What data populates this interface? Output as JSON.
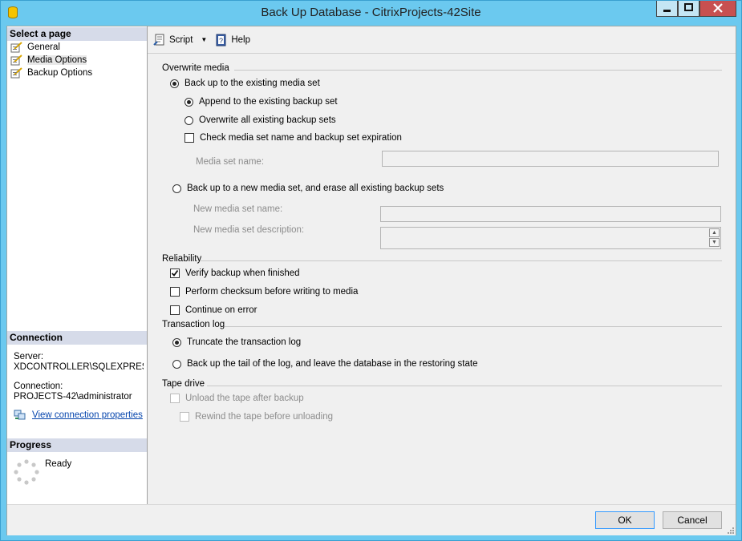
{
  "window": {
    "title": "Back Up Database - CitrixProjects-42Site"
  },
  "left": {
    "select_page_header": "Select a page",
    "pages": [
      {
        "label": "General"
      },
      {
        "label": "Media Options"
      },
      {
        "label": "Backup Options"
      }
    ],
    "connection_header": "Connection",
    "server_label": "Server:",
    "server_value": "XDCONTROLLER\\SQLEXPRESS",
    "connection_label": "Connection:",
    "connection_value": "PROJECTS-42\\administrator",
    "view_connection_link": "View connection properties",
    "progress_header": "Progress",
    "progress_status": "Ready"
  },
  "toolbar": {
    "script_label": "Script",
    "help_label": "Help"
  },
  "overwrite_media": {
    "title": "Overwrite media",
    "existing_media_set": "Back up to the existing media set",
    "append": "Append to the existing backup set",
    "overwrite_all": "Overwrite all existing backup sets",
    "check_name_expiration": "Check media set name and backup set expiration",
    "media_set_name_label": "Media set name:",
    "new_media_set": "Back up to a new media set, and erase all existing backup sets",
    "new_media_set_name_label": "New media set name:",
    "new_media_set_desc_label": "New media set description:"
  },
  "reliability": {
    "title": "Reliability",
    "verify": "Verify backup when finished",
    "checksum": "Perform checksum before writing to media",
    "continue_on_error": "Continue on error"
  },
  "transaction_log": {
    "title": "Transaction log",
    "truncate": "Truncate the transaction log",
    "tail": "Back up the tail of the log, and leave the database in the restoring state"
  },
  "tape_drive": {
    "title": "Tape drive",
    "unload": "Unload the tape after backup",
    "rewind": "Rewind the tape before unloading"
  },
  "buttons": {
    "ok": "OK",
    "cancel": "Cancel"
  }
}
